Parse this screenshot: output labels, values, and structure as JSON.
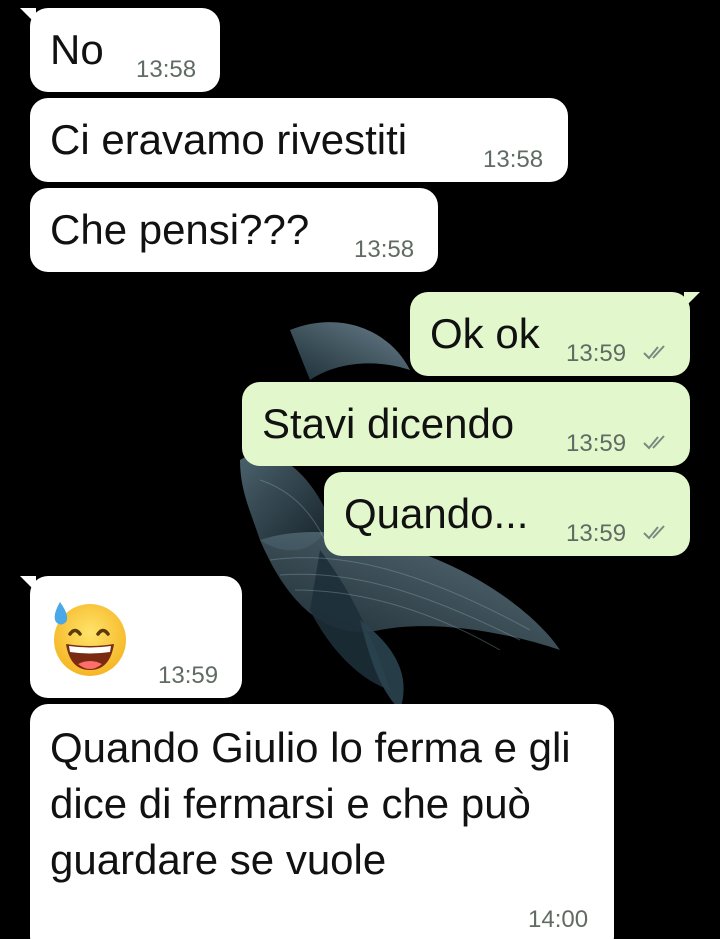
{
  "messages": [
    {
      "id": "m1",
      "direction": "incoming",
      "text": "No",
      "time": "13:58"
    },
    {
      "id": "m2",
      "direction": "incoming",
      "text": "Ci eravamo rivestiti",
      "time": "13:58"
    },
    {
      "id": "m3",
      "direction": "incoming",
      "text": "Che pensi???",
      "time": "13:58"
    },
    {
      "id": "m4",
      "direction": "outgoing",
      "text": "Ok ok",
      "time": "13:59",
      "status_icon": "double-check-icon"
    },
    {
      "id": "m5",
      "direction": "outgoing",
      "text": "Stavi dicendo",
      "time": "13:59",
      "status_icon": "double-check-icon"
    },
    {
      "id": "m6",
      "direction": "outgoing",
      "text": "Quando...",
      "time": "13:59",
      "status_icon": "double-check-icon"
    },
    {
      "id": "m7",
      "direction": "incoming",
      "emoji": "grinning-face-with-sweat-icon",
      "time": "13:59"
    },
    {
      "id": "m8",
      "direction": "incoming",
      "text": "Quando Giulio lo ferma e gli dice di fermarsi e che può guardare se vuole",
      "time": "14:00"
    }
  ],
  "colors": {
    "background": "#000000",
    "incoming_bubble": "#ffffff",
    "outgoing_bubble": "#e2f8cc",
    "timestamp": "#5f6b63",
    "tick": "#7b8a80"
  },
  "wallpaper": "betta-fish-wallpaper"
}
